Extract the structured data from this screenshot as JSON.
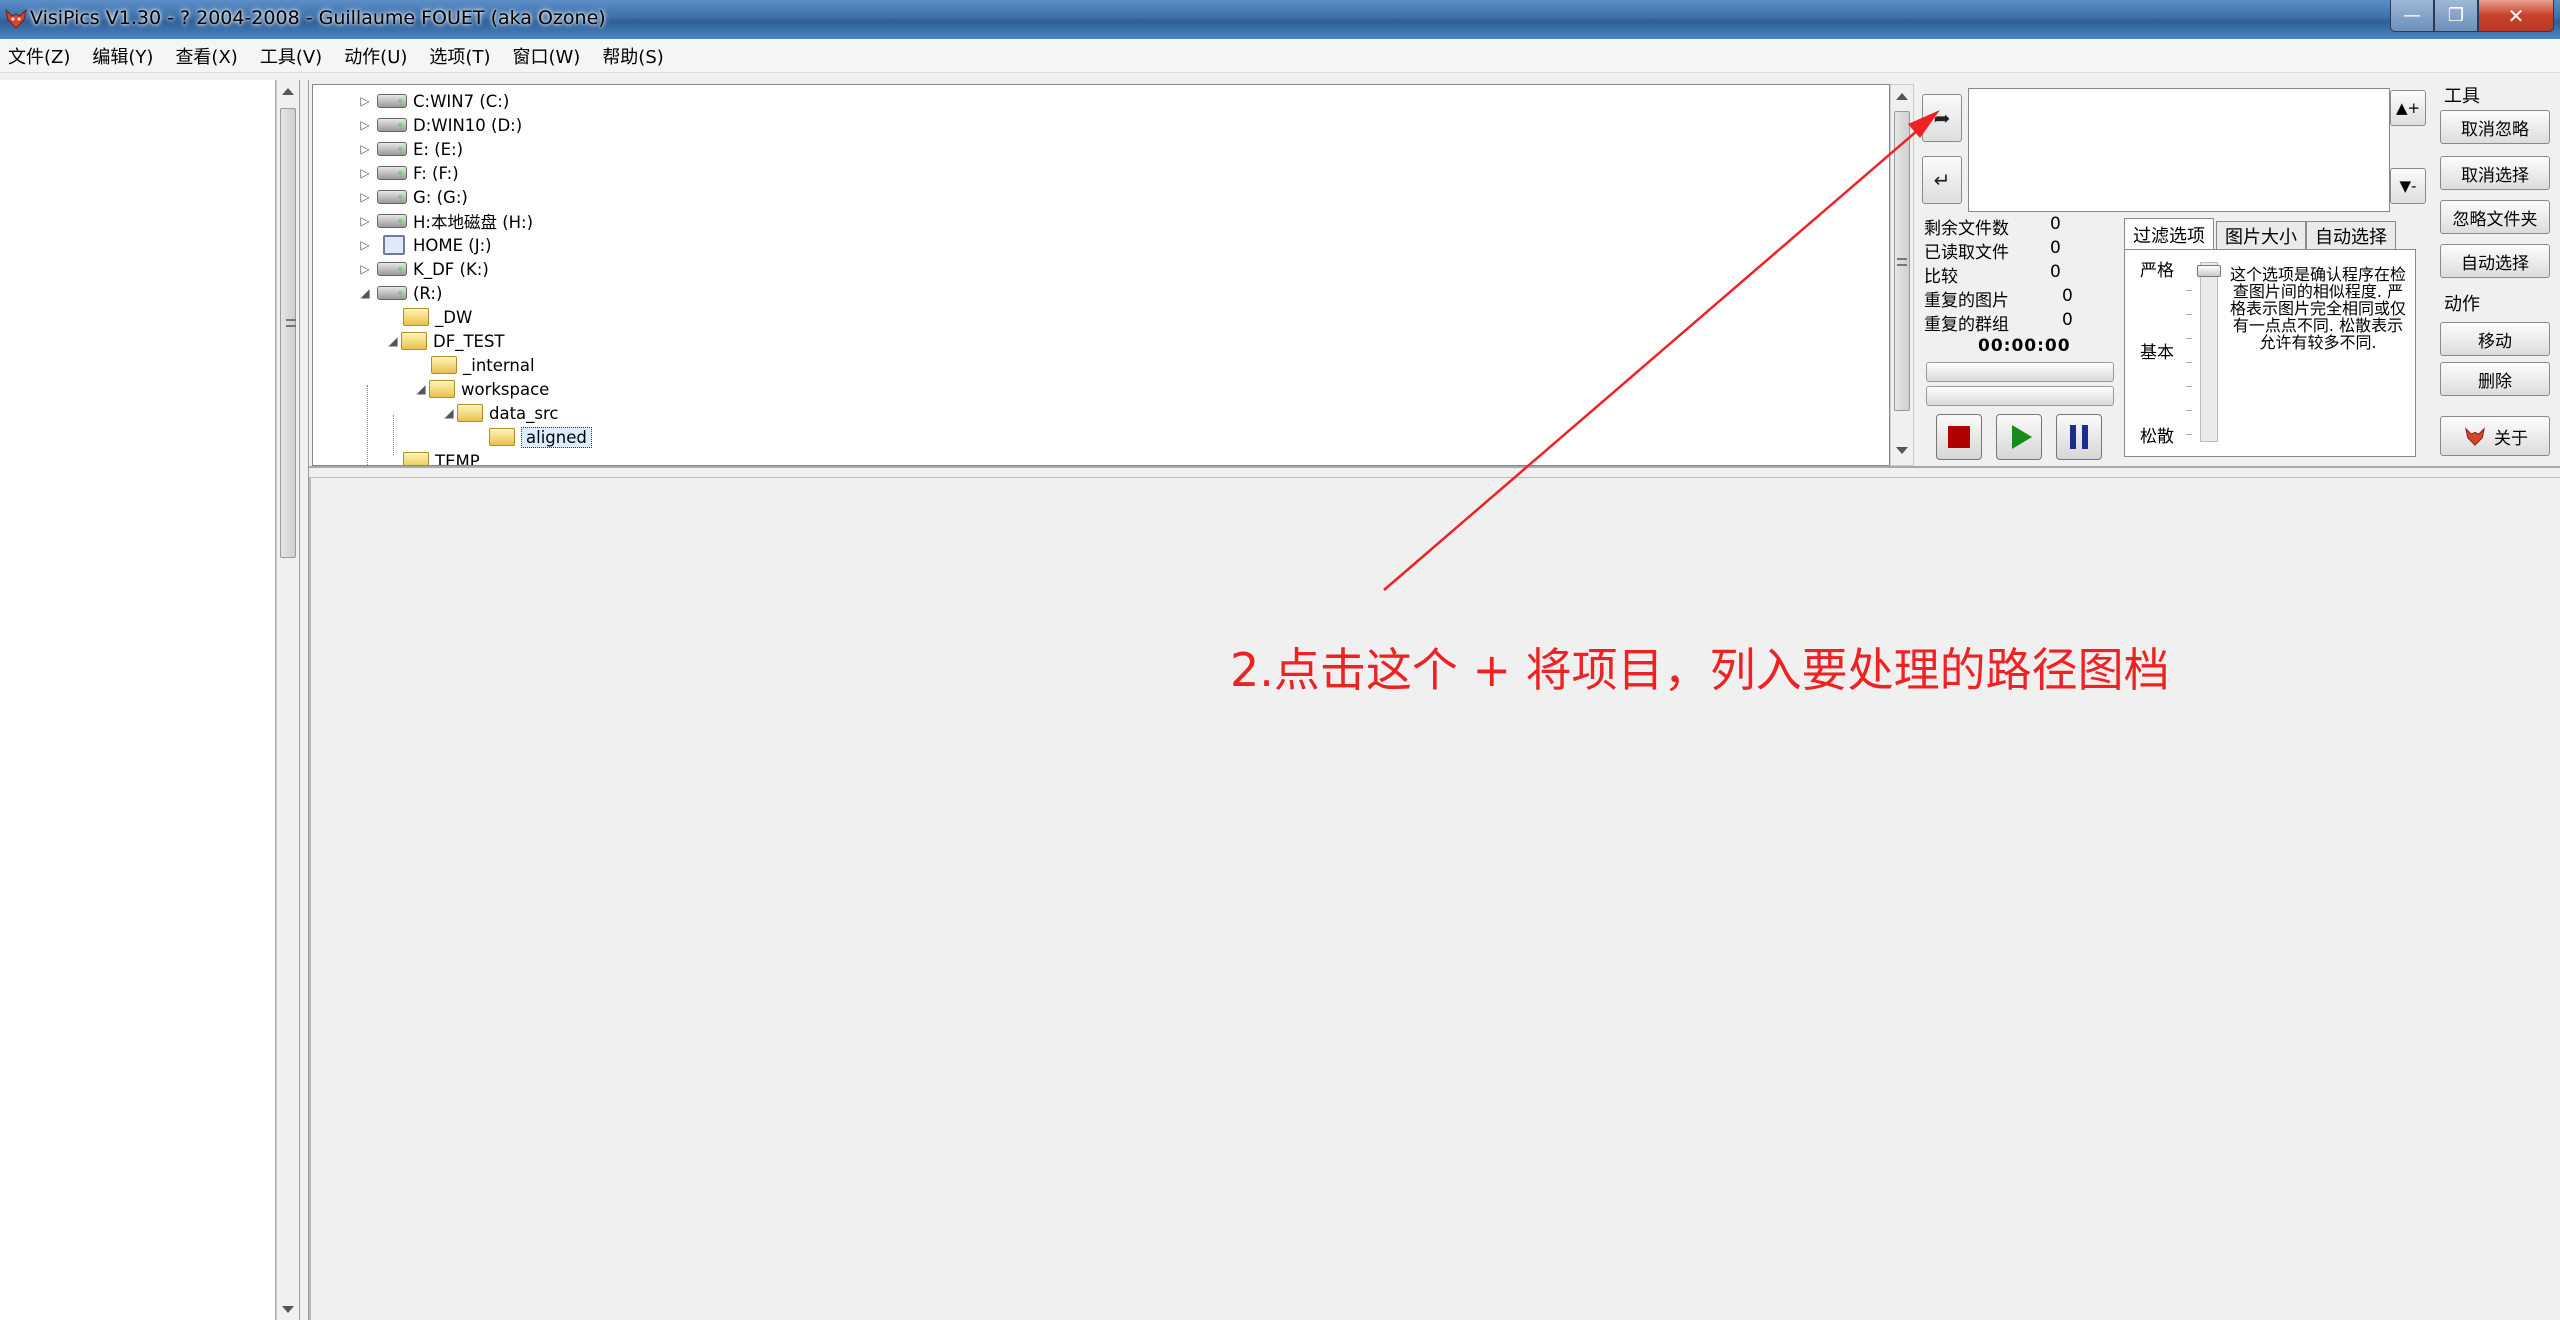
{
  "window": {
    "title": "VisiPics V1.30 - ? 2004-2008 - Guillaume FOUET (aka Ozone)",
    "app_icon": "fox-logo-icon",
    "buttons": {
      "minimize": "minimize-icon",
      "maximize": "maximize-icon",
      "close": "close-icon"
    }
  },
  "menu": [
    "文件(Z)",
    "编辑(Y)",
    "查看(X)",
    "工具(V)",
    "动作(U)",
    "选项(T)",
    "窗口(W)",
    "帮助(S)"
  ],
  "tree": {
    "drives": [
      "C:WIN7 (C:)",
      "D:WIN10 (D:)",
      "E: (E:)",
      "F: (F:)",
      "G: (G:)",
      "H:本地磁盘 (H:)",
      "HOME (J:)",
      "K_DF (K:)",
      "(R:)"
    ],
    "folders": [
      "_DW",
      "DF_TEST",
      "_internal",
      "workspace",
      "data_src",
      "aligned",
      "TEMP"
    ],
    "selected": "aligned"
  },
  "stats": {
    "remaining_label": "剩余文件数",
    "remaining_value": "0",
    "loaded_label": "已读取文件",
    "loaded_value": "0",
    "compare_label": "比较",
    "compare_value": "0",
    "dup_images_label": "重复的图片",
    "dup_images_value": "0",
    "dup_groups_label": "重复的群组",
    "dup_groups_value": "0",
    "timer": "00:00:00"
  },
  "tabs": [
    "过滤选项",
    "图片大小",
    "自动选择"
  ],
  "active_tab": "过滤选项",
  "filter": {
    "levels": [
      "严格",
      "基本",
      "松散"
    ],
    "description": "这个选项是确认程序在检查图片间的相似程度. 严格表示图片完全相同或仅有一点点不同. 松散表示允许有较多不同."
  },
  "tools": {
    "label": "工具",
    "buttons": [
      "取消忽略",
      "取消选择",
      "忽略文件夹",
      "自动选择"
    ]
  },
  "actions": {
    "label": "动作",
    "buttons": [
      "移动",
      "删除"
    ]
  },
  "about_label": "关于",
  "annotation": "2.点击这个 + 将项目，列入要处理的路径图档",
  "colors": {
    "annotation": "#ee2222",
    "stop": "#b00000",
    "play": "#1a8a1a",
    "pause": "#1b2f8a"
  }
}
